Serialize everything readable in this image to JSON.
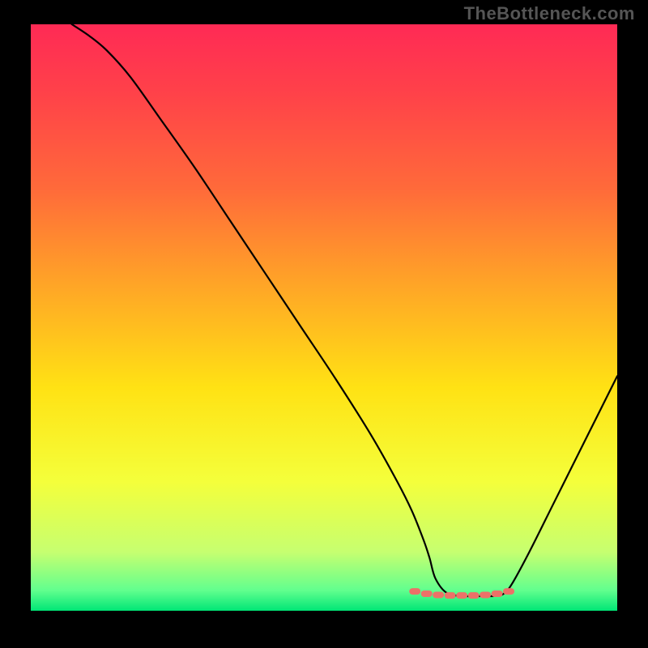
{
  "watermark": "TheBottleneck.com",
  "chart_data": {
    "type": "line",
    "title": "",
    "xlabel": "",
    "ylabel": "",
    "xlim": [
      0,
      100
    ],
    "ylim": [
      0,
      100
    ],
    "series": [
      {
        "name": "curve",
        "color": "#000000",
        "x": [
          7,
          10,
          13,
          17,
          22,
          28,
          34,
          40,
          46,
          52,
          58,
          62.5,
          65,
          67,
          68,
          69,
          71,
          74,
          77,
          79,
          80.5,
          82,
          85,
          89,
          93,
          97,
          100
        ],
        "y": [
          100,
          98,
          95.5,
          91,
          84,
          75.5,
          66.5,
          57.5,
          48.5,
          39.5,
          30,
          22,
          17,
          12,
          9,
          5.5,
          3,
          2.5,
          2.5,
          2.5,
          2.8,
          4.5,
          10,
          18,
          26,
          34,
          40
        ]
      },
      {
        "name": "valley-markers",
        "color": "#ec7168",
        "x": [
          65.5,
          67.5,
          69.5,
          71.5,
          73.5,
          75.5,
          77.5,
          79.5,
          81.5
        ],
        "y": [
          3.3,
          2.9,
          2.7,
          2.6,
          2.6,
          2.6,
          2.7,
          2.9,
          3.3
        ]
      }
    ],
    "gradient_stops": [
      {
        "offset": 0,
        "color": "#ff2a55"
      },
      {
        "offset": 0.12,
        "color": "#ff4249"
      },
      {
        "offset": 0.28,
        "color": "#ff6a3a"
      },
      {
        "offset": 0.45,
        "color": "#ffa726"
      },
      {
        "offset": 0.62,
        "color": "#ffe214"
      },
      {
        "offset": 0.78,
        "color": "#f4ff3b"
      },
      {
        "offset": 0.9,
        "color": "#c6ff70"
      },
      {
        "offset": 0.965,
        "color": "#62ff8e"
      },
      {
        "offset": 1.0,
        "color": "#00e676"
      }
    ]
  }
}
